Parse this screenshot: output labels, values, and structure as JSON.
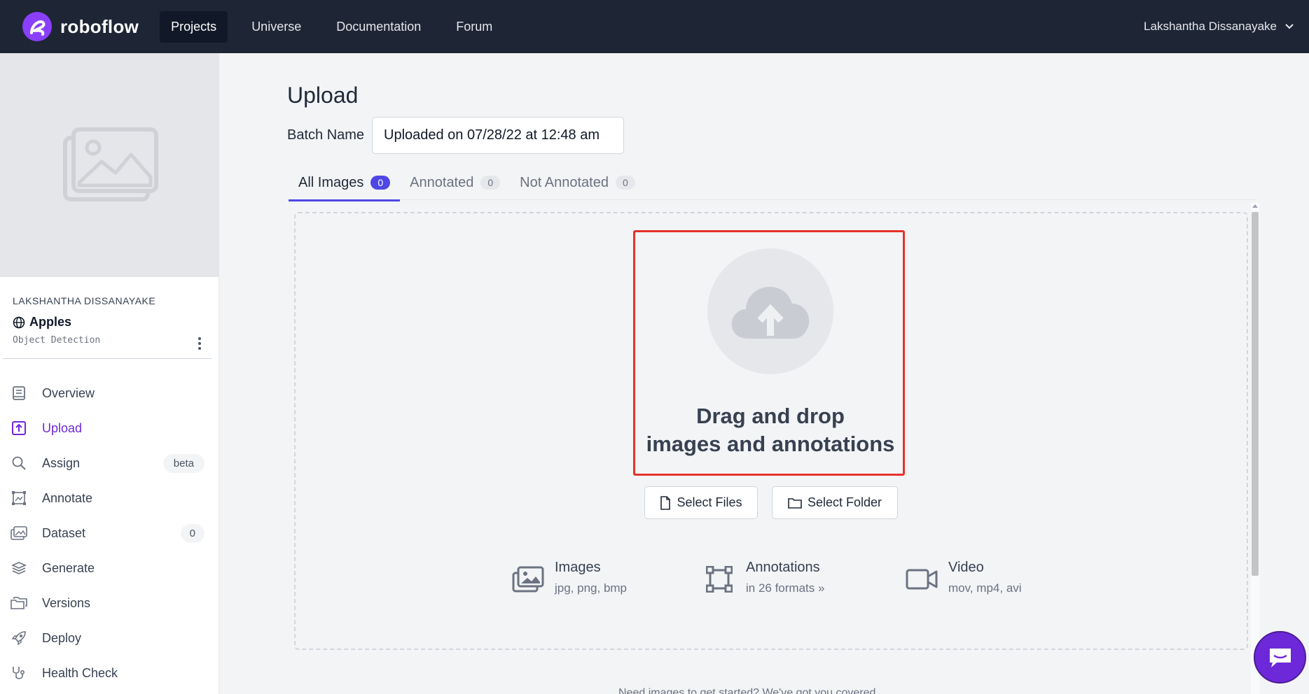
{
  "brand": {
    "name": "roboflow",
    "accent": "#8a3ffc"
  },
  "nav": {
    "links": [
      "Projects",
      "Universe",
      "Documentation",
      "Forum"
    ],
    "active": "Projects",
    "user_name": "Lakshantha Dissanayake"
  },
  "sidebar": {
    "workspace": "LAKSHANTHA DISSANAYAKE",
    "project_name": "Apples",
    "project_type": "Object Detection",
    "items": [
      {
        "label": "Overview",
        "icon": "book-icon"
      },
      {
        "label": "Upload",
        "icon": "upload-icon",
        "active": true
      },
      {
        "label": "Assign",
        "icon": "search-icon",
        "badge": "beta"
      },
      {
        "label": "Annotate",
        "icon": "annotate-icon"
      },
      {
        "label": "Dataset",
        "icon": "images-icon",
        "badge": "0"
      },
      {
        "label": "Generate",
        "icon": "layers-icon"
      },
      {
        "label": "Versions",
        "icon": "folders-icon"
      },
      {
        "label": "Deploy",
        "icon": "rocket-icon"
      },
      {
        "label": "Health Check",
        "icon": "stethoscope-icon"
      }
    ]
  },
  "main": {
    "title": "Upload",
    "batch_label": "Batch Name",
    "batch_value": "Uploaded on 07/28/22 at 12:48 am",
    "tabs": [
      {
        "label": "All Images",
        "count": "0",
        "active": true
      },
      {
        "label": "Annotated",
        "count": "0"
      },
      {
        "label": "Not Annotated",
        "count": "0"
      }
    ],
    "dropzone": {
      "line1": "Drag and drop",
      "line2": "images and annotations",
      "select_files": "Select Files",
      "select_folder": "Select Folder"
    },
    "formats": [
      {
        "title": "Images",
        "sub": "jpg, png, bmp",
        "icon": "images-icon"
      },
      {
        "title": "Annotations",
        "sub": "in 26 formats »",
        "icon": "bounding-box-icon"
      },
      {
        "title": "Video",
        "sub": "mov, mp4, avi",
        "icon": "video-icon"
      }
    ],
    "footer_text": "Need images to get started? We've got you covered."
  }
}
